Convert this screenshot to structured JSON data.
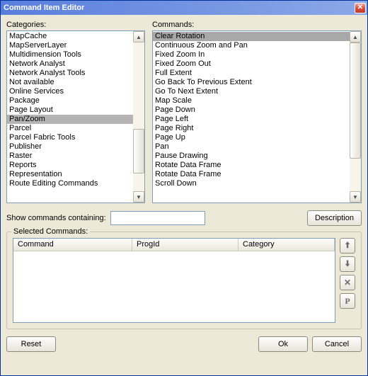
{
  "window": {
    "title": "Command Item Editor"
  },
  "labels": {
    "categories": "Categories:",
    "commands": "Commands:",
    "show_containing": "Show commands containing:",
    "selected_commands": "Selected Commands:"
  },
  "categories": {
    "selected_index": 9,
    "items": [
      "MapCache",
      "MapServerLayer",
      "Multidimension Tools",
      "Network Analyst",
      "Network Analyst Tools",
      "Not available",
      "Online Services",
      "Package",
      "Page Layout",
      "Pan/Zoom",
      "Parcel",
      "Parcel Fabric Tools",
      "Publisher",
      "Raster",
      "Reports",
      "Representation",
      "Route Editing Commands"
    ]
  },
  "commands": {
    "selected_index": 0,
    "items": [
      "Clear Rotation",
      "Continuous Zoom and Pan",
      "Fixed Zoom In",
      "Fixed Zoom Out",
      "Full Extent",
      "Go Back To Previous Extent",
      "Go To Next Extent",
      "Map Scale",
      "Page Down",
      "Page Left",
      "Page Right",
      "Page Up",
      "Pan",
      "Pause Drawing",
      "Rotate Data Frame",
      "Rotate Data Frame",
      "Scroll Down"
    ]
  },
  "filter": {
    "value": ""
  },
  "buttons": {
    "description": "Description",
    "reset": "Reset",
    "ok": "Ok",
    "cancel": "Cancel"
  },
  "table": {
    "columns": [
      "Command",
      "ProgId",
      "Category"
    ]
  },
  "icons": {
    "close": "✕",
    "up_arrow": "▲",
    "down_arrow": "▼",
    "move_up": "🠩",
    "move_down": "🠫",
    "delete": "✕",
    "p_label": "P"
  }
}
